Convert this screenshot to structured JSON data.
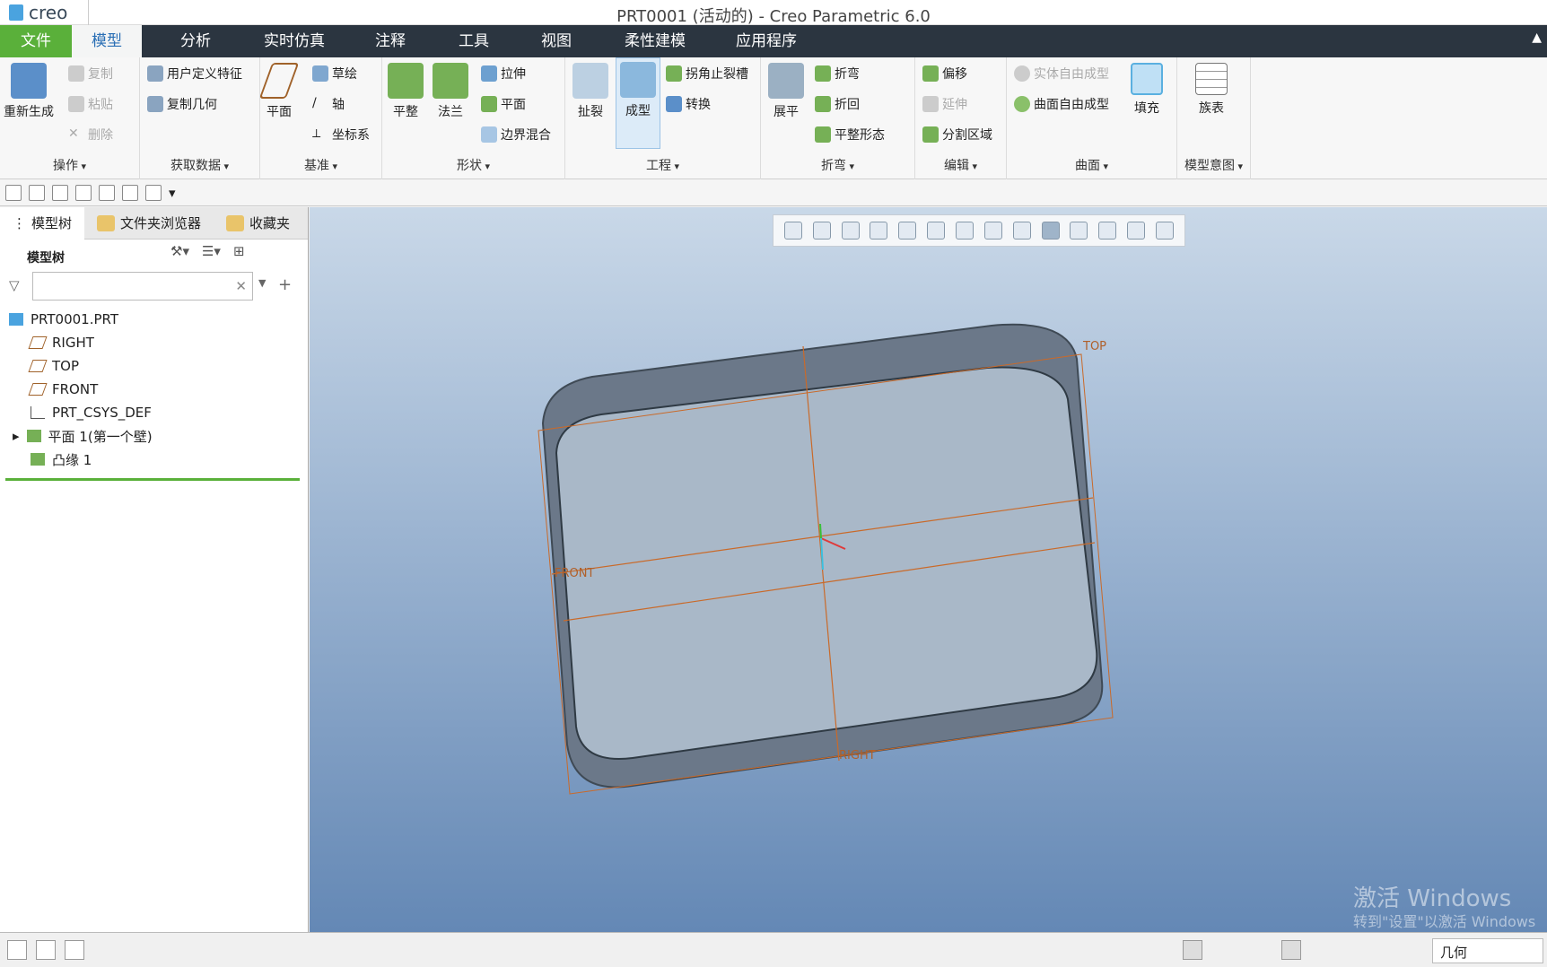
{
  "app": {
    "logo": "creo",
    "title": "PRT0001 (活动的) - Creo Parametric 6.0"
  },
  "tabs": [
    "文件",
    "模型",
    "分析",
    "实时仿真",
    "注释",
    "工具",
    "视图",
    "柔性建模",
    "应用程序"
  ],
  "ribbon": {
    "ops": {
      "regen": "重新生成",
      "copy": "复制",
      "paste": "粘贴",
      "delete": "删除",
      "label": "操作"
    },
    "getdata": {
      "udf": "用户定义特征",
      "copygeom": "复制几何",
      "label": "获取数据"
    },
    "datum": {
      "plane": "平面",
      "sketch": "草绘",
      "axis": "轴",
      "csys": "坐标系",
      "label": "基准"
    },
    "shape": {
      "flat": "平整",
      "flange": "法兰",
      "extrude": "拉伸",
      "plane": "平面",
      "blend": "边界混合",
      "label": "形状"
    },
    "eng": {
      "rip": "扯裂",
      "form": "成型",
      "corner": "拐角止裂槽",
      "convert": "转换",
      "label": "工程"
    },
    "bend": {
      "unbend": "展平",
      "bend": "折弯",
      "bendback": "折回",
      "flatpattern": "平整形态",
      "label": "折弯"
    },
    "edit": {
      "offset": "偏移",
      "extend": "延伸",
      "split": "分割区域",
      "label": "编辑"
    },
    "surface": {
      "solidfree": "实体自由成型",
      "surffree": "曲面自由成型",
      "fill": "填充",
      "label": "曲面"
    },
    "intent": {
      "family": "族表",
      "label": "模型意图"
    }
  },
  "sidebar": {
    "tabs": [
      "模型树",
      "文件夹浏览器",
      "收藏夹"
    ],
    "tree_title": "模型树",
    "items": [
      "PRT0001.PRT",
      "RIGHT",
      "TOP",
      "FRONT",
      "PRT_CSYS_DEF",
      "平面 1(第一个壁)",
      "凸缘 1"
    ]
  },
  "viewport": {
    "label_top": "TOP",
    "label_front": "FRONT",
    "label_right": "RIGHT"
  },
  "watermark": {
    "line1": "激活 Windows",
    "line2": "转到\"设置\"以激活 Windows"
  },
  "status": {
    "filter": "几何"
  },
  "colors": {
    "accent": "#5ab03a",
    "tabbar": "#2b3540",
    "part": "#7a8696",
    "datum": "#c96a2a"
  }
}
